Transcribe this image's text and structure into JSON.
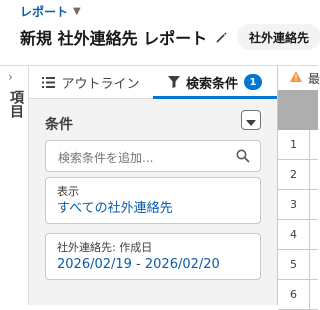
{
  "header": {
    "breadcrumb": "レポート",
    "title": "新規 社外連絡先 レポート",
    "type_pill": "社外連絡先"
  },
  "side_rail": {
    "label": "項目"
  },
  "tabs": [
    {
      "label": "アウトライン",
      "icon": "list-icon",
      "active": false
    },
    {
      "label": "検索条件",
      "icon": "filter-icon",
      "active": true,
      "count": "1"
    }
  ],
  "filters_panel": {
    "section_title": "条件",
    "search_placeholder": "検索条件を追加...",
    "cards": [
      {
        "label": "表示",
        "value": "すべての社外連絡先"
      },
      {
        "label": "社外連絡先: 作成日",
        "value": "2026/02/19 - 2026/02/20"
      }
    ]
  },
  "preview": {
    "warning_text": "最",
    "row_numbers": [
      "1",
      "2",
      "3",
      "4",
      "5",
      "6"
    ]
  },
  "colors": {
    "accent": "#0176d3",
    "link": "#0b5cab",
    "warning": "#fe9339",
    "panel_bg": "#f3f3f3"
  }
}
